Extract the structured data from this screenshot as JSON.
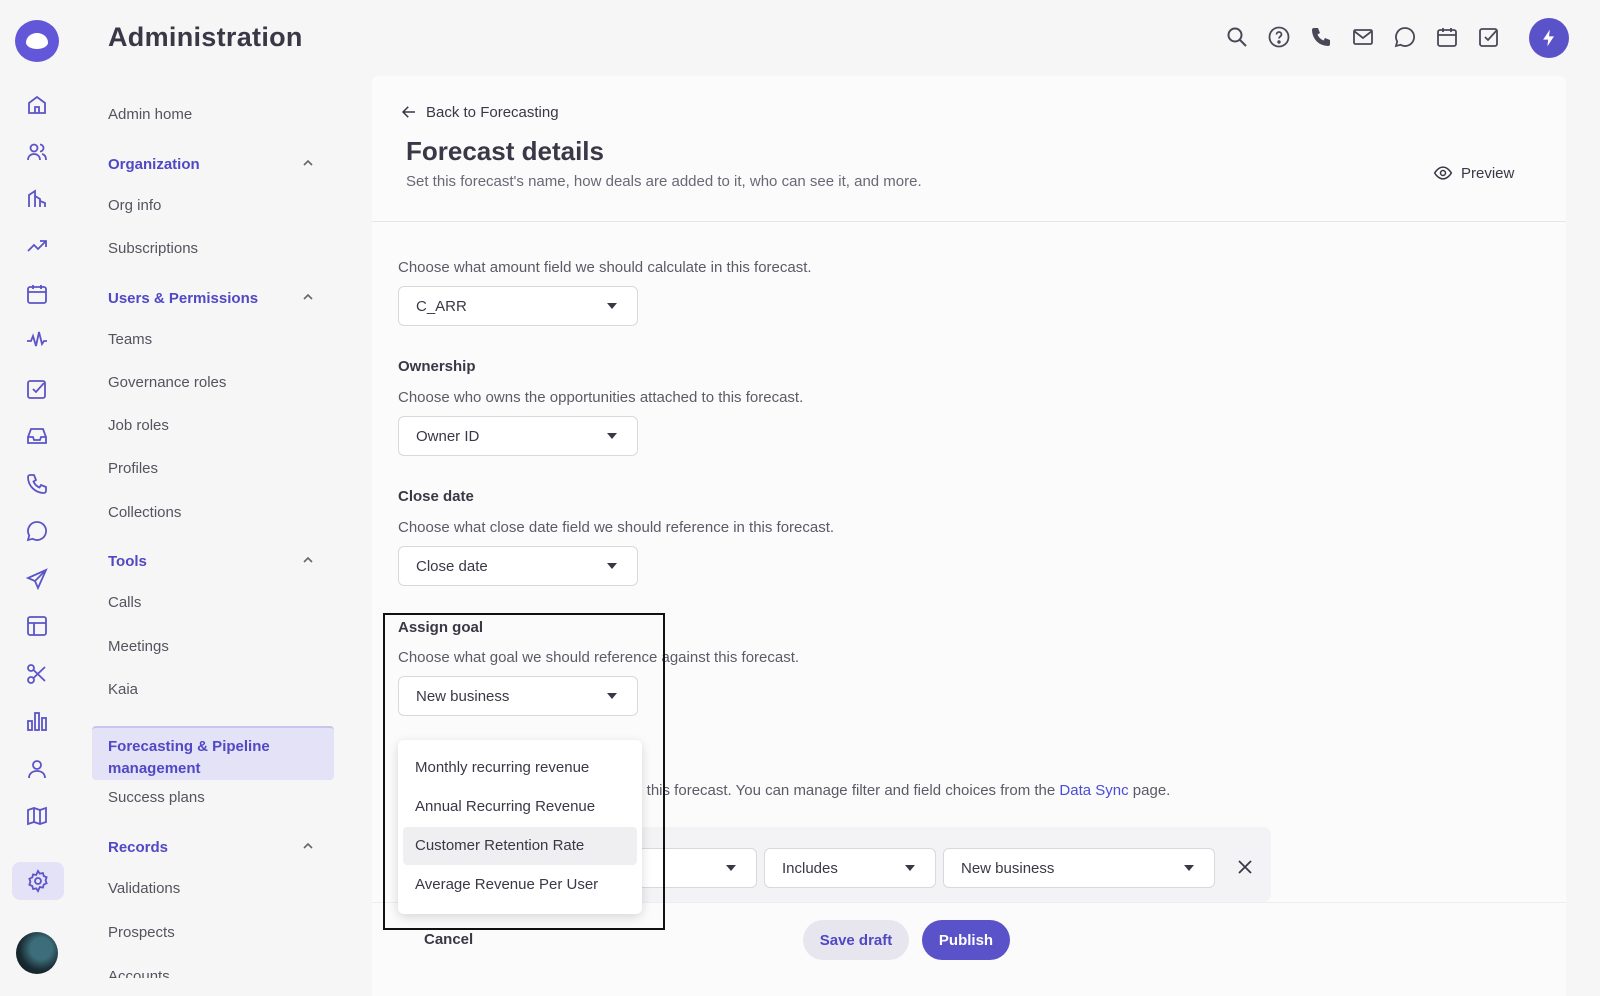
{
  "app": {
    "title": "Administration"
  },
  "header_icons": [
    "search-icon",
    "help-icon",
    "phone-icon",
    "mail-icon",
    "chat-icon",
    "calendar-icon",
    "task-icon",
    "bolt-icon"
  ],
  "rail_icons": [
    "home-icon",
    "people-icon",
    "accounts-icon",
    "trend-icon",
    "calendar-icon",
    "activity-icon",
    "tasks-icon",
    "inbox-icon",
    "phone-icon",
    "chat-icon",
    "send-icon",
    "layout-icon",
    "scissors-icon",
    "chart-icon",
    "user-icon",
    "map-icon",
    "settings-icon"
  ],
  "nav": {
    "admin_home": "Admin home",
    "groups": [
      {
        "label": "Organization",
        "items": [
          "Org info",
          "Subscriptions"
        ]
      },
      {
        "label": "Users & Permissions",
        "items": [
          "Teams",
          "Governance roles",
          "Job roles",
          "Profiles",
          "Collections"
        ]
      },
      {
        "label": "Tools",
        "items": [
          "Calls",
          "Meetings",
          "Kaia"
        ]
      },
      {
        "label": "Records",
        "items": [
          "Validations",
          "Prospects",
          "Accounts"
        ]
      }
    ],
    "active": "Forecasting & Pipeline management",
    "after_active": "Success plans"
  },
  "page": {
    "back_link": "Back to Forecasting",
    "title": "Forecast details",
    "subtitle": "Set this forecast's name, how deals are added to it, who can see it, and more.",
    "preview": "Preview"
  },
  "sections": {
    "amount": {
      "desc": "Choose what amount field we should calculate in this forecast.",
      "value": "C_ARR"
    },
    "ownership": {
      "label": "Ownership",
      "desc": "Choose who owns the opportunities attached to this forecast.",
      "value": "Owner ID"
    },
    "close_date": {
      "label": "Close date",
      "desc": "Choose what close date field we should reference in this forecast.",
      "value": "Close date"
    },
    "assign_goal": {
      "label": "Assign goal",
      "desc": "Choose what goal we should reference against this forecast.",
      "value": "New business"
    },
    "filters": {
      "desc_prefix": "to this forecast. You can manage filter and field choices from the",
      "link": "Data Sync",
      "desc_suffix": "page.",
      "operator": "Includes",
      "value": "New business"
    }
  },
  "dropdown": {
    "options": [
      "Monthly recurring revenue",
      "Annual Recurring Revenue",
      "Customer Retention Rate",
      "Average Revenue Per User"
    ],
    "hovered": "Customer Retention Rate"
  },
  "footer": {
    "cancel": "Cancel",
    "save_draft": "Save draft",
    "publish": "Publish"
  },
  "colors": {
    "accent": "#5a52c8",
    "accent_light": "#e4e2f6",
    "link": "#4a4cd6"
  }
}
